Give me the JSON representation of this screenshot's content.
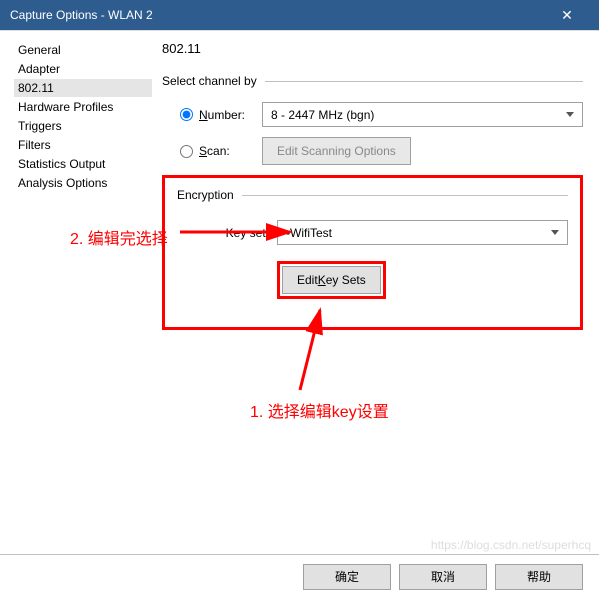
{
  "window": {
    "title": "Capture Options - WLAN 2",
    "close": "✕"
  },
  "sidebar": {
    "items": [
      {
        "label": "General"
      },
      {
        "label": "Adapter"
      },
      {
        "label": "802.11"
      },
      {
        "label": "Hardware Profiles"
      },
      {
        "label": "Triggers"
      },
      {
        "label": "Filters"
      },
      {
        "label": "Statistics Output"
      },
      {
        "label": "Analysis Options"
      }
    ],
    "selected_index": 2
  },
  "page": {
    "title": "802.11",
    "select_channel_by": "Select channel by",
    "number_label": "Number:",
    "scan_label": "Scan:",
    "channel_value": "8 - 2447 MHz (bgn)",
    "edit_scanning": "Edit Scanning Options",
    "encryption_label": "Encryption",
    "key_set_label": "Key set:",
    "key_set_value": "-WifiTest",
    "edit_key_sets": "Edit Key Sets"
  },
  "annotations": {
    "step1": "1. 选择编辑key设置",
    "step2": "2. 编辑完选择"
  },
  "footer": {
    "ok": "确定",
    "cancel": "取消",
    "help": "帮助"
  },
  "watermark": "https://blog.csdn.net/superhcq"
}
